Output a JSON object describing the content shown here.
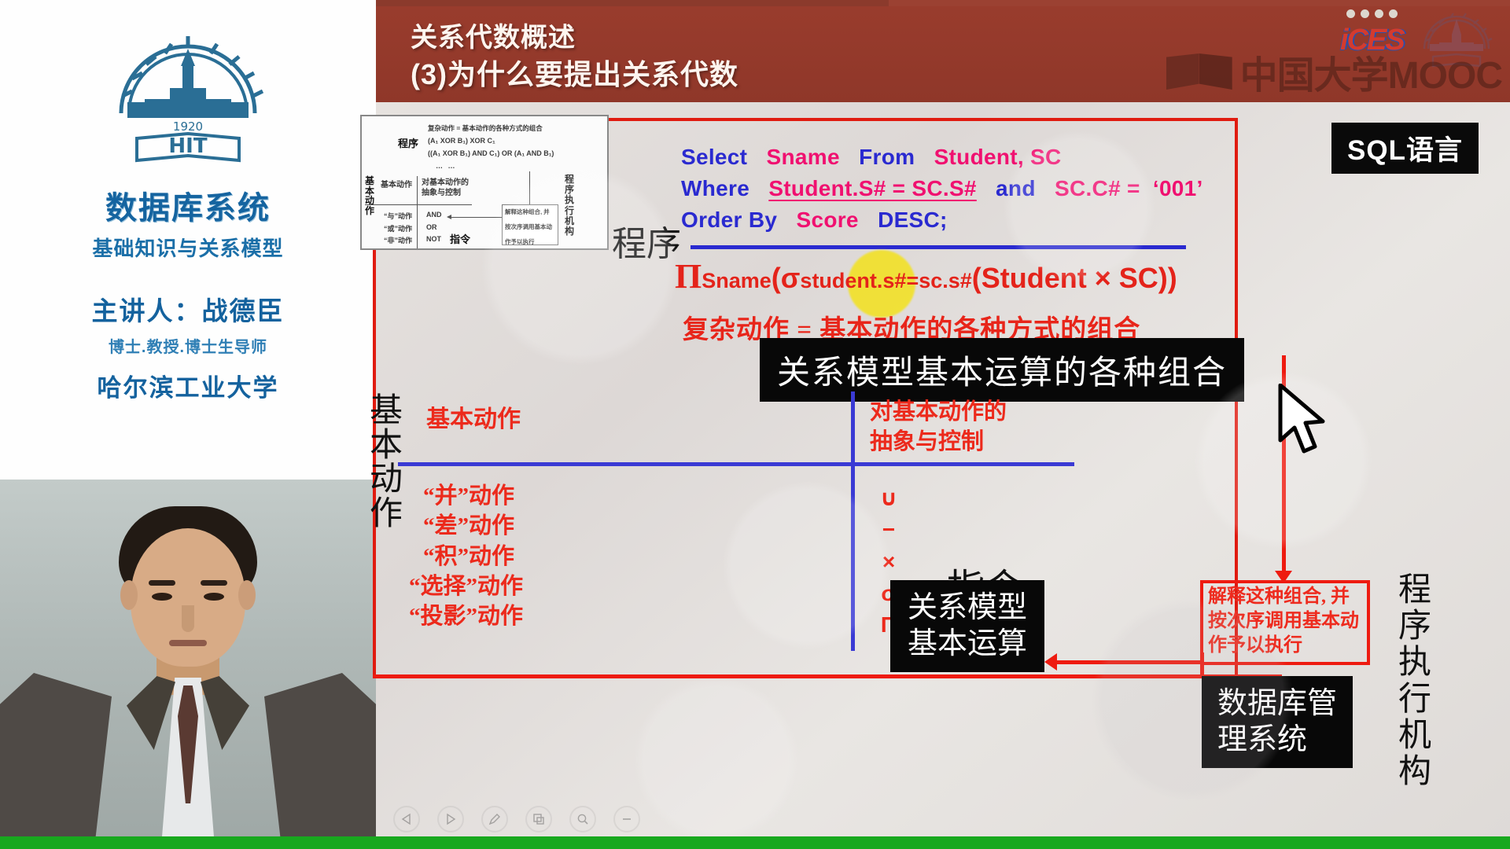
{
  "brand": {
    "logo_icon": "hit-crest-icon",
    "course_title": "数据库系统",
    "course_subtitle": "基础知识与关系模型",
    "lecturer_line": "主讲人：战德臣",
    "lecturer_titles": "博士.教授.博士生导师",
    "university": "哈尔滨工业大学"
  },
  "header": {
    "title": "关系代数概述",
    "subtitle": "(3)为什么要提出关系代数",
    "bg_color": "#993c2d",
    "watermark_text": "中国大学MOOC",
    "ices_text": "iCES"
  },
  "slide": {
    "sql_badge": "SQL语言",
    "sql": {
      "l1": [
        {
          "t": "Select",
          "c": "kw"
        },
        {
          "t": "Sname",
          "c": "id"
        },
        {
          "t": "From",
          "c": "kw"
        },
        {
          "t": "Student, SC",
          "c": "id"
        }
      ],
      "l2": [
        {
          "t": "Where",
          "c": "kw"
        },
        {
          "t": "Student.S# = SC.S#",
          "c": "id u"
        },
        {
          "t": "and",
          "c": "kw"
        },
        {
          "t": "SC.C# =",
          "c": "id"
        },
        {
          "t": "‘001’",
          "c": "id"
        }
      ],
      "l3": [
        {
          "t": "Order By",
          "c": "kw"
        },
        {
          "t": "Score",
          "c": "id"
        },
        {
          "t": "DESC;",
          "c": "kw"
        }
      ]
    },
    "program_label": "程序",
    "ra_formula_parts": {
      "pi": "Π",
      "sub1": "Sname",
      "open": "(",
      "sigma": "σ",
      "sub2": "student.s#=sc.s#",
      "tail": "(Student × SC))"
    },
    "complex_action_eq": "复杂动作 = 基本动作的各种方式的组合",
    "combo_badge": "关系模型基本运算的各种组合",
    "quadrant": {
      "left_axis_label": "基本动作",
      "top_left": "基本动作",
      "top_right_l1": "对基本动作的",
      "top_right_l2": "抽象与控制",
      "bottom_left_items": [
        "“并”动作",
        "“差”动作",
        "“积”动作",
        "“选择”动作",
        "“投影”动作"
      ],
      "bottom_right_symbols": [
        "∪",
        "−",
        "×",
        "σ",
        "Π"
      ],
      "instruction_label": "指令"
    },
    "ops_badge_l1": "关系模型",
    "ops_badge_l2": "基本运算",
    "interp_box_l1": "解释这种组合, 并",
    "interp_box_l2": "按次序调用基本动",
    "interp_box_l3": "作予以执行",
    "exec_vert_label": "程序执行机构",
    "dbms_badge_l1": "数据库管",
    "dbms_badge_l2": "理系统",
    "thumbnail": {
      "program": "程序",
      "line1": "复杂动作 = 基本动作的各种方式的组合",
      "line2": "(A₁ XOR B₁) XOR C₁",
      "line3": "((A₁ XOR B₁) AND C₁) OR (A₁ AND B₁)",
      "line4": "… …",
      "left_axis": "基本动作",
      "col1": "基本动作",
      "col2_l1": "对基本动作的",
      "col2_l2": "抽象与控制",
      "actions": [
        "“与”动作",
        "“或”动作",
        "“非”动作"
      ],
      "ops": [
        "AND",
        "OR",
        "NOT"
      ],
      "instruction": "指令",
      "box_l1": "解释这种组合, 并",
      "box_l2": "按次序调用基本动",
      "box_l3": "作予以执行",
      "exec": "程序执行机构"
    }
  },
  "controls": {
    "items": [
      {
        "name": "prev-slide-button",
        "icon": "triangle-left-icon"
      },
      {
        "name": "next-slide-button",
        "icon": "triangle-right-icon"
      },
      {
        "name": "pen-tool-button",
        "icon": "pen-icon"
      },
      {
        "name": "screenshot-button",
        "icon": "copy-icon"
      },
      {
        "name": "zoom-button",
        "icon": "magnifier-icon"
      },
      {
        "name": "minimize-button",
        "icon": "minus-icon"
      }
    ]
  },
  "colors": {
    "header_bg": "#993c2d",
    "sql_keyword": "#2a2ad0",
    "sql_identifier": "#f01070",
    "red_accent": "#ee1b10",
    "blue_rule": "#2a2ad0",
    "progress_green": "#18a81e"
  }
}
